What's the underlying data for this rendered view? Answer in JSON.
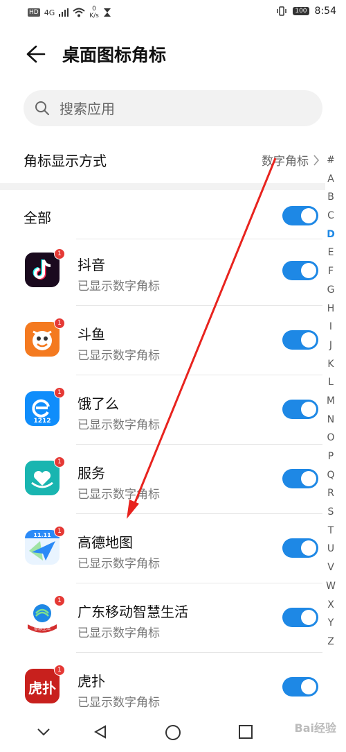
{
  "status_bar": {
    "left_badge": "HD",
    "signal_label": "4G",
    "net_speed_value": "0",
    "net_speed_unit": "K/s",
    "battery": "100",
    "time": "8:54"
  },
  "header": {
    "title": "桌面图标角标"
  },
  "search": {
    "placeholder": "搜索应用"
  },
  "mode_row": {
    "label": "角标显示方式",
    "value": "数字角标"
  },
  "all_row": {
    "label": "全部"
  },
  "apps": [
    {
      "name": "抖音",
      "status": "已显示数字角标",
      "badge": "1",
      "color": "#1a0a1e"
    },
    {
      "name": "斗鱼",
      "status": "已显示数字角标",
      "badge": "1",
      "color": "#f47a20"
    },
    {
      "name": "饿了么",
      "status": "已显示数字角标",
      "badge": "1",
      "color": "#0f8dfb"
    },
    {
      "name": "服务",
      "status": "已显示数字角标",
      "badge": "1",
      "color": "#19b5b0"
    },
    {
      "name": "高德地图",
      "status": "已显示数字角标",
      "badge": "1",
      "color": "#2b8af7"
    },
    {
      "name": "广东移动智慧生活",
      "status": "已显示数字角标",
      "badge": "1",
      "color": "#ffffff"
    },
    {
      "name": "虎扑",
      "status": "已显示数字角标",
      "badge": "1",
      "color": "#c8201d"
    }
  ],
  "app_icon_texts": {
    "eleme": "1212",
    "gaode": "11.11",
    "gd_mobile": "智慧生活",
    "hupu": "虎扑"
  },
  "index_letters": [
    "#",
    "A",
    "B",
    "C",
    "D",
    "E",
    "F",
    "G",
    "H",
    "I",
    "J",
    "K",
    "L",
    "M",
    "N",
    "O",
    "P",
    "Q",
    "R",
    "S",
    "T",
    "U",
    "V",
    "W",
    "X",
    "Y",
    "Z"
  ],
  "index_active": "D",
  "watermark": "Bai经验",
  "colors": {
    "accent": "#1e88e5",
    "badge_red": "#e53935",
    "arrow_red": "#e8231e"
  }
}
